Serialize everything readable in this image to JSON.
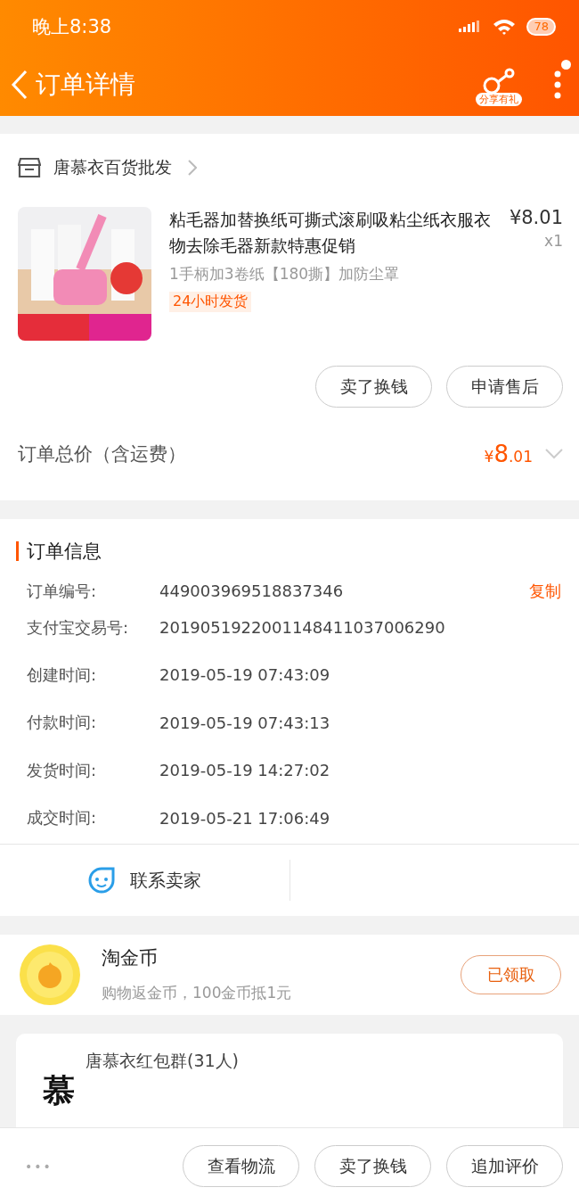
{
  "status_bar": {
    "time": "晚上8:38",
    "battery": "78"
  },
  "nav": {
    "title": "订单详情",
    "share_label": "分享有礼",
    "menu_badge": true
  },
  "shop": {
    "name": "唐慕衣百货批发"
  },
  "product": {
    "title": "粘毛器加替换纸可撕式滚刷吸粘尘纸衣服衣物去除毛器新款特惠促销",
    "price": "¥8.01",
    "quantity": "x1",
    "sku": "1手柄加3卷纸【180撕】加防尘罩",
    "tag": "24小时发货",
    "actions": [
      "卖了换钱",
      "申请售后"
    ]
  },
  "total": {
    "label": "订单总价（含运费）",
    "currency": "¥",
    "integer": "8",
    "decimal": ".01",
    "expanded": false
  },
  "order_info": {
    "title": "订单信息",
    "copy": "复制",
    "rows": [
      {
        "label": "订单编号:",
        "value": "449003969518837346"
      },
      {
        "label": "支付宝交易号:",
        "value": "2019051922001148411037006290"
      },
      {
        "label": "创建时间:",
        "value": "2019-05-19 07:43:09"
      },
      {
        "label": "付款时间:",
        "value": "2019-05-19 07:43:13"
      },
      {
        "label": "发货时间:",
        "value": "2019-05-19 14:27:02"
      },
      {
        "label": "成交时间:",
        "value": "2019-05-21 17:06:49"
      }
    ],
    "contact": "联系卖家"
  },
  "coins": {
    "title": "淘金币",
    "subtitle": "购物返金币，100金币抵1元",
    "button": "已领取"
  },
  "group": {
    "logo": "慕",
    "name": "唐慕衣红包群(31人)"
  },
  "bottom_bar": {
    "more": "•••",
    "buttons": [
      "查看物流",
      "卖了换钱",
      "追加评价"
    ]
  }
}
